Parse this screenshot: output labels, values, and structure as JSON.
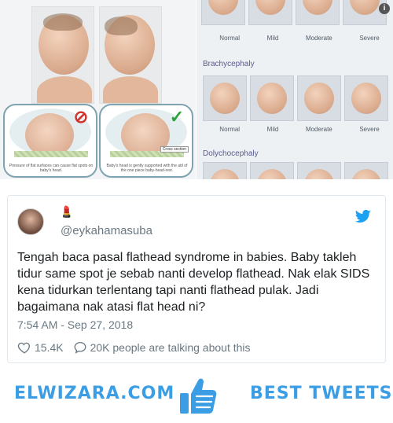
{
  "media": {
    "severity_labels": [
      "Normal",
      "Mild",
      "Moderate",
      "Severe"
    ],
    "sections": {
      "brachy": "Brachycephaly",
      "dolycho": "Dolychocephaly"
    },
    "brachy_labels": [
      "Normal",
      "Mild",
      "Moderate",
      "Severe"
    ],
    "card_left_note": "Pressure of flat surfaces can cause flat spots on baby's head.",
    "card_right_note": "Baby's head is gently supported with the aid of the one piece baby-head-rest.",
    "cross_section": "Cross section"
  },
  "tweet": {
    "emoji": "💄",
    "handle": "@eykahamasuba",
    "text": "Tengah baca pasal flathead syndrome in babies. Baby takleh tidur same spot je sebab nanti develop flathead. Nak elak SIDS kena tidurkan terlentang tapi nanti flathead pulak. Jadi bagaimana nak atasi flat head ni?",
    "time": "7:54 AM - Sep 27, 2018",
    "likes": "15.4K",
    "talking": "20K people are talking about this"
  },
  "footer": {
    "brand": "ELWIZARA.COM",
    "tagline": "BEST TWEETS"
  },
  "colors": {
    "brand_blue": "#3b9ee4",
    "twitter_blue": "#1da1f2",
    "muted": "#697882"
  }
}
